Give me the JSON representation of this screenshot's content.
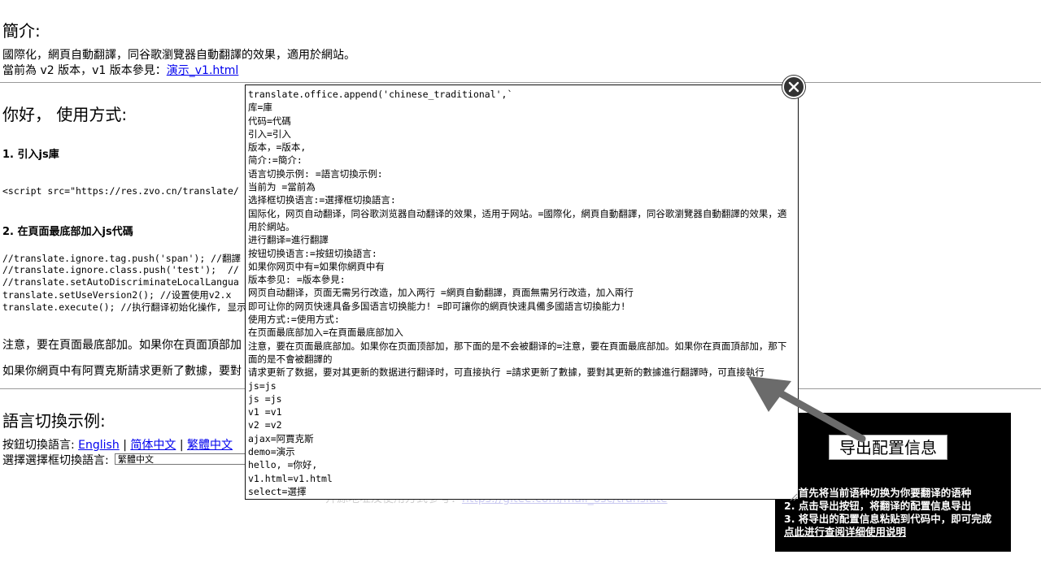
{
  "intro": {
    "heading": "簡介:",
    "desc": "國際化，網頁自動翻譯，同谷歌瀏覽器自動翻譯的效果，適用於網站。",
    "version_prefix": "當前為 v2 版本，v1 版本參見：",
    "version_link": "演示_v1.html"
  },
  "usage": {
    "heading": "你好， 使用方式:",
    "step1_title": "1. 引入js庫",
    "step1_code": "<script src=\"https://res.zvo.cn/translate/",
    "step2_title": "2. 在頁面最底部加入js代碼",
    "code_lines": [
      "//translate.ignore.tag.push('span'); //翻譯",
      "//translate.ignore.class.push('test');  //",
      "//translate.setAutoDiscriminateLocalLangua",
      "translate.setUseVersion2(); //设置使用v2.x ",
      "translate.execute(); //执行翻译初始化操作, 显示"
    ],
    "note1": "注意，要在頁面最底部加。如果你在頁面頂部加",
    "note2": "如果你網頁中有阿賈克斯請求更新了數據，要對"
  },
  "lang_switch": {
    "heading": "語言切換示例:",
    "button_prefix": "按鈕切換語言: ",
    "lang_english": "English",
    "lang_simplified": "简体中文",
    "lang_traditional": "繁體中文",
    "separator": "|",
    "select_prefix": "選擇選擇框切換語言: ",
    "select_value": "繁體中文"
  },
  "footer": {
    "text": "开源地址及使用方式参考：",
    "link": "https://gitee.com/mail_osc/translate"
  },
  "popup": {
    "content": "translate.office.append('chinese_traditional',`\n库=庫\n代码=代碼\n引入=引入\n版本，=版本,\n简介:=簡介:\n语言切换示例: =語言切換示例:\n当前为 =當前為\n选择框切换语言:=選擇框切換語言:\n国际化，网页自动翻译，同谷歌浏览器自动翻译的效果，适用于网站。=國際化，網頁自動翻譯，同谷歌瀏覽器自動翻譯的效果，適用於網站。\n进行翻译=進行翻譯\n按钮切换语言:=按鈕切換語言:\n如果你网页中有=如果你網頁中有\n版本参见: =版本參見:\n网页自动翻译，页面无需另行改造，加入两行 =網頁自動翻譯，頁面無需另行改造，加入兩行\n即可让你的网页快速具备多国语言切换能力! =即可讓你的網頁快速具備多國語言切換能力!\n使用方式:=使用方式:\n在页面最底部加入=在頁面最底部加入\n注意，要在页面最底部加。如果你在页面顶部加，那下面的是不会被翻译的=注意，要在頁面最底部加。如果你在頁面頂部加，那下面的是不會被翻譯的\n请求更新了数据，要对其更新的数据进行翻译时，可直接执行 =請求更新了數據，要對其更新的數據進行翻譯時，可直接執行\njs=js\njs =js\nv1 =v1\nv2 =v2\najax=阿賈克斯\ndemo=演示\nhello, =你好,\nv1.html=v1.html\nselect=選擇\n`);"
  },
  "info_panel": {
    "export_button": "导出配置信息",
    "line1": "1. 首先将当前语种切换为你要翻译的语种",
    "line2": "2. 点击导出按钮，将翻译的配置信息导出",
    "line3": "3. 将导出的配置信息粘贴到代码中，即可完成",
    "help_link": "点此进行查阅详细使用说明"
  },
  "colors": {
    "link": "#0000ee",
    "panel_bg": "#000000",
    "arrow": "#6b6b6b"
  }
}
